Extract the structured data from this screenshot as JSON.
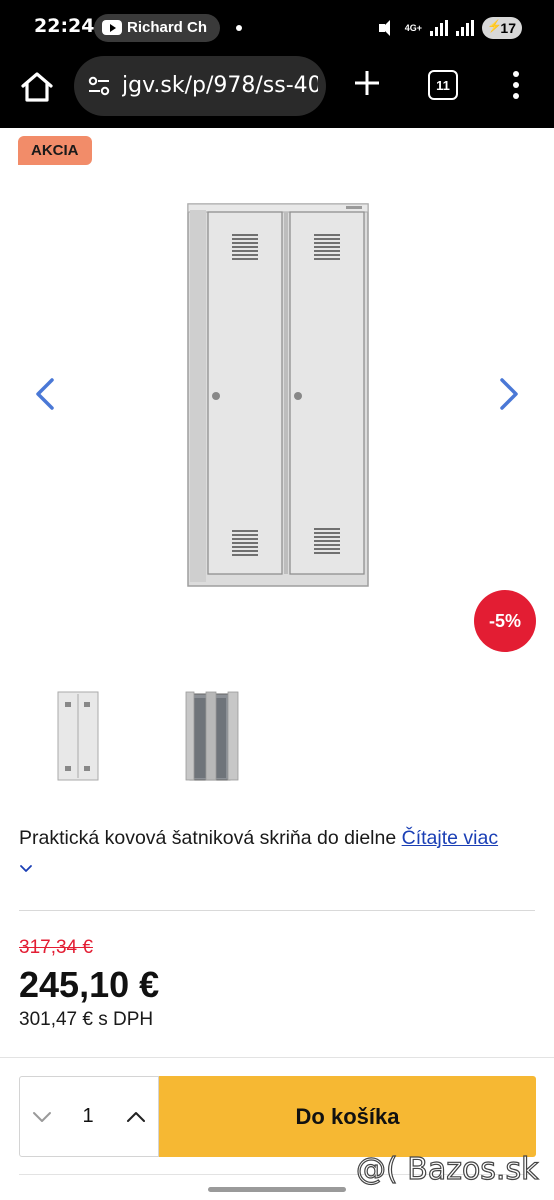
{
  "status_bar": {
    "time": "22:24",
    "notification_text": "Richard Ch",
    "network_label": "4G+",
    "battery_level": "17"
  },
  "browser": {
    "url": "jgv.sk/p/978/ss-40",
    "tab_count": "11"
  },
  "product": {
    "badge": "AKCIA",
    "discount": "-5%",
    "description": "Praktická kovová šatniková skriňa do dielne",
    "read_more": "Čítajte viac",
    "old_price": "317,34 €",
    "price": "245,10 €",
    "price_vat": "301,47 € s DPH"
  },
  "cart": {
    "quantity": "1",
    "button_label": "Do košíka"
  },
  "watermark": "@( Bazos.sk",
  "colors": {
    "badge": "#f28c69",
    "discount": "#e31d33",
    "cart_button": "#f6b833",
    "link": "#1a3fb5",
    "arrow": "#4a78d6"
  }
}
